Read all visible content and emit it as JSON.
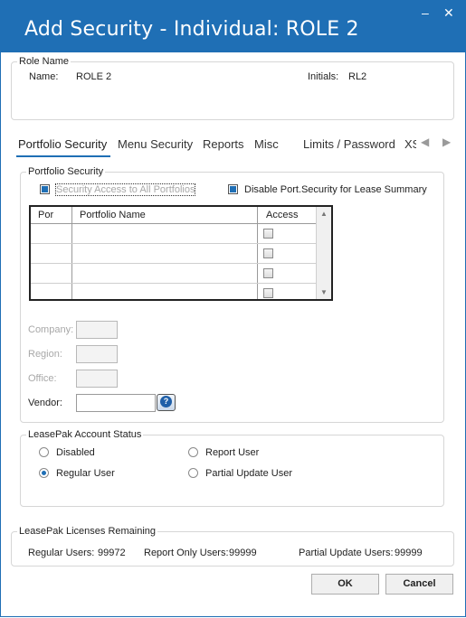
{
  "window": {
    "title": "Add Security - Individual: ROLE 2",
    "minimize_glyph": "–",
    "close_glyph": "✕"
  },
  "role": {
    "legend": "Role Name",
    "name_label": "Name:",
    "name_value": "ROLE 2",
    "initials_label": "Initials:",
    "initials_value": "RL2"
  },
  "tabs": [
    {
      "label": "Portfolio Security",
      "active": true
    },
    {
      "label": "Menu Security"
    },
    {
      "label": "Reports"
    },
    {
      "label": "Misc"
    },
    {
      "label": "Limits / Password"
    },
    {
      "label": "XS"
    }
  ],
  "portfolio": {
    "legend": "Portfolio Security",
    "access_all_label": "Security Access to All Portfolios",
    "access_all_checked": true,
    "disable_label": "Disable Port.Security for Lease Summary",
    "disable_checked": true,
    "columns": [
      "Por",
      "Portfolio Name",
      "Access"
    ],
    "rows": [
      {
        "por": "",
        "name": "",
        "access": false
      },
      {
        "por": "",
        "name": "",
        "access": false
      },
      {
        "por": "",
        "name": "",
        "access": false
      },
      {
        "por": "",
        "name": "",
        "access": false
      }
    ],
    "company_label": "Company:",
    "region_label": "Region:",
    "office_label": "Office:",
    "vendor_label": "Vendor:",
    "help_icon": "question-icon"
  },
  "status": {
    "legend": "LeasePak Account Status",
    "options": [
      {
        "label": "Disabled",
        "selected": false
      },
      {
        "label": "Report User",
        "selected": false
      },
      {
        "label": "Regular User",
        "selected": true
      },
      {
        "label": "Partial Update User",
        "selected": false
      }
    ]
  },
  "licenses": {
    "legend": "LeasePak Licenses Remaining",
    "regular_label": "Regular Users:",
    "regular_value": "99972",
    "report_label": "Report Only Users:",
    "report_value": "99999",
    "partial_label": "Partial Update Users:",
    "partial_value": "99999"
  },
  "buttons": {
    "ok": "OK",
    "cancel": "Cancel"
  },
  "colors": {
    "titlebar": "#1f6fb5",
    "accent": "#1f6fb5"
  }
}
